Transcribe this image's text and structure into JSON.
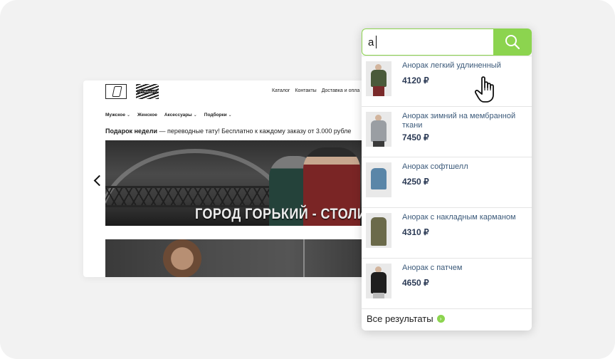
{
  "site": {
    "logo_text": "ПРОВИНЦИЯ",
    "topnav": [
      "Каталог",
      "Контакты",
      "Доставка и опла"
    ],
    "subnav": [
      "Мужское",
      "Женское",
      "Аксессуары",
      "Подборки"
    ],
    "promo_bold": "Подарок недели",
    "promo_text": " — переводные тату! Бесплатно к каждому заказу от 3.000 рубле",
    "banner_text": "ГОРОД ГОРЬКИЙ - СТОЛИЦА А"
  },
  "search": {
    "value": "а",
    "button_icon": "search-icon"
  },
  "results": [
    {
      "name": "Анорак легкий удлиненный",
      "price": "4120 ₽",
      "color": "#4a5a3a"
    },
    {
      "name": "Анорак зимний на мембранной ткани",
      "price": "7450 ₽",
      "color": "#9a9ea3"
    },
    {
      "name": "Анорак софтшелл",
      "price": "4250 ₽",
      "color": "#5a86a8"
    },
    {
      "name": "Анорак с накладным карманом",
      "price": "4310 ₽",
      "color": "#6b6a4a"
    },
    {
      "name": "Анорак с патчем",
      "price": "4650 ₽",
      "color": "#1e1e1e"
    }
  ],
  "all_results_label": "Все результаты",
  "colors": {
    "accent": "#8cd44f",
    "link": "#3c5a7a"
  }
}
